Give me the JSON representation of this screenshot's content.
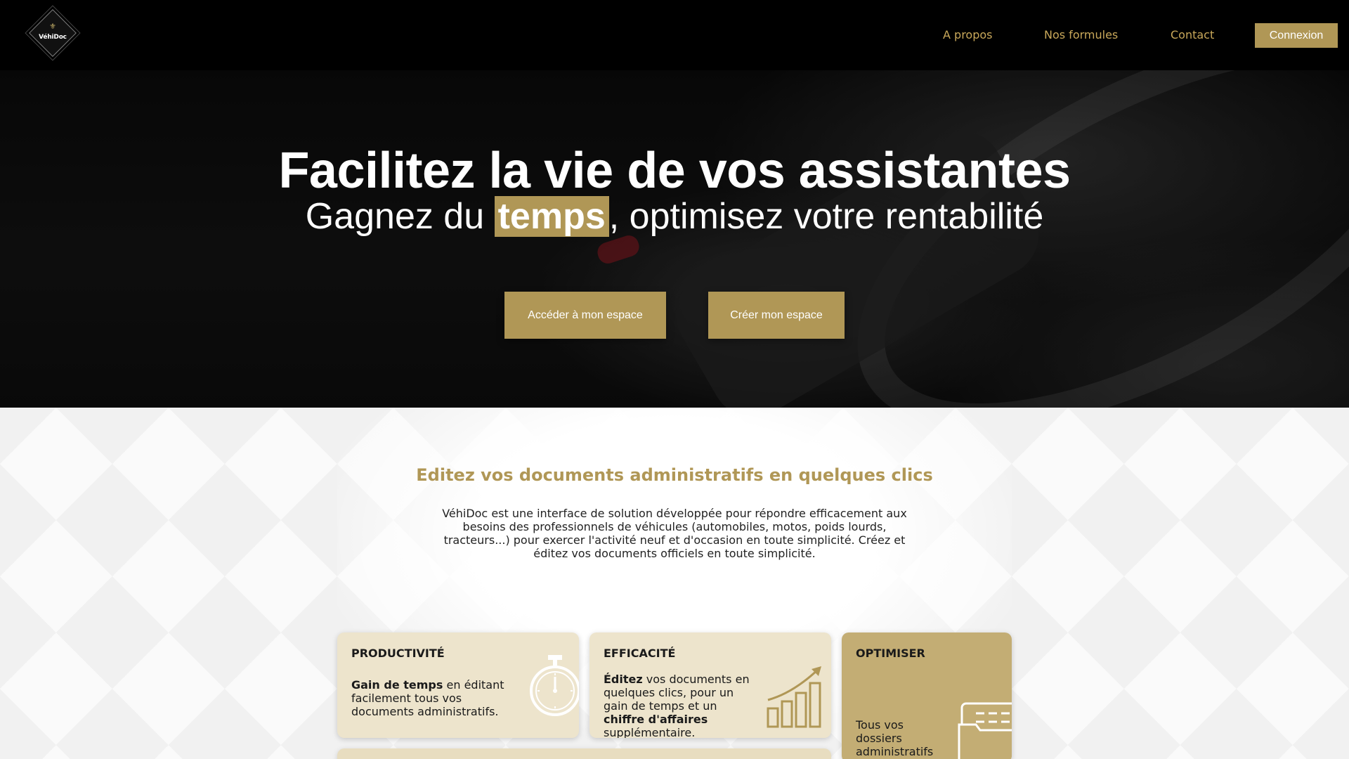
{
  "brand": {
    "logo_text": "VéhiDoc",
    "logo_mark": "⚜"
  },
  "nav": {
    "links": [
      "A propos",
      "Nos formules",
      "Contact"
    ],
    "login_label": "Connexion"
  },
  "hero": {
    "title": "Facilitez la vie de vos assistantes",
    "subtitle_before": "Gagnez du ",
    "subtitle_highlight": "temps",
    "subtitle_after": ", optimisez votre rentabilité",
    "primary_button": "Accéder à mon espace",
    "secondary_button": "Créer mon espace"
  },
  "intro": {
    "title": "Editez vos documents administratifs en quelques clics",
    "text": "VéhiDoc est une interface de solution développée pour répondre efficacement aux besoins des professionnels de véhicules (automobiles, motos, poids lourds, tracteurs...) pour exercer l'activité neuf et d'occasion en toute simplicité. Créez et éditez vos documents officiels en toute simplicité."
  },
  "cards": [
    {
      "title": "PRODUCTIVITÉ",
      "bold1": "Gain de temps",
      "text1": " en éditant facilement tous vos documents administratifs.",
      "icon": "stopwatch-icon"
    },
    {
      "title": "EFFICACITÉ",
      "bold1": "Éditez",
      "text1": " vos documents en quelques clics, pour un gain de temps et un ",
      "bold2": "chiffre d'affaires",
      "text2": " supplémentaire.",
      "icon": "growth-chart-icon"
    },
    {
      "title": "OPTIMISER",
      "text1": "Tous vos dossiers administratifs multi-sites",
      "icon": "folder-icon"
    }
  ],
  "colors": {
    "accent": "#b09756",
    "nav_bg": "#000000",
    "card_light": "#ede4cc",
    "card_dark": "#c3ad74"
  }
}
